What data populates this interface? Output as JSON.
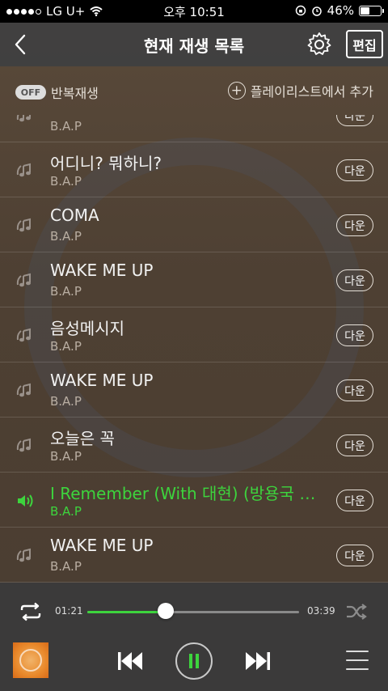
{
  "status_bar": {
    "carrier": "LG U+",
    "time": "오후 10:51",
    "battery_text": "46%",
    "battery_level": 0.46
  },
  "nav": {
    "title": "현재 재생 목록",
    "edit_label": "편집",
    "back_icon": "chevron-left-icon",
    "settings_icon": "gear-icon"
  },
  "options": {
    "repeat_badge": "OFF",
    "repeat_label": "반복재생",
    "add_playlist_label": "플레이리스트에서 추가"
  },
  "songs": [
    {
      "title": "",
      "artist": "B.A.P",
      "down": "다운",
      "playing": false
    },
    {
      "title": "어디니? 뭐하니?",
      "artist": "B.A.P",
      "down": "다운",
      "playing": false
    },
    {
      "title": "COMA",
      "artist": "B.A.P",
      "down": "다운",
      "playing": false
    },
    {
      "title": "WAKE ME UP",
      "artist": "B.A.P",
      "down": "다운",
      "playing": false
    },
    {
      "title": "음성메시지",
      "artist": "B.A.P",
      "down": "다운",
      "playing": false
    },
    {
      "title": "WAKE ME UP",
      "artist": "B.A.P",
      "down": "다운",
      "playing": false
    },
    {
      "title": "오늘은 꼭",
      "artist": "B.A.P",
      "down": "다운",
      "playing": false
    },
    {
      "title": "I Remember (With 대현) (방용국 Solo)",
      "artist": "B.A.P",
      "down": "다운",
      "playing": true
    },
    {
      "title": "WAKE ME UP",
      "artist": "B.A.P",
      "down": "다운",
      "playing": false
    }
  ],
  "player": {
    "current_time": "01:21",
    "total_time": "03:39",
    "progress": 0.37,
    "state": "playing"
  },
  "colors": {
    "accent": "#3dd43d",
    "background": "#4c3e31",
    "navbar": "#3c3e42",
    "player": "#3a3a3a"
  }
}
